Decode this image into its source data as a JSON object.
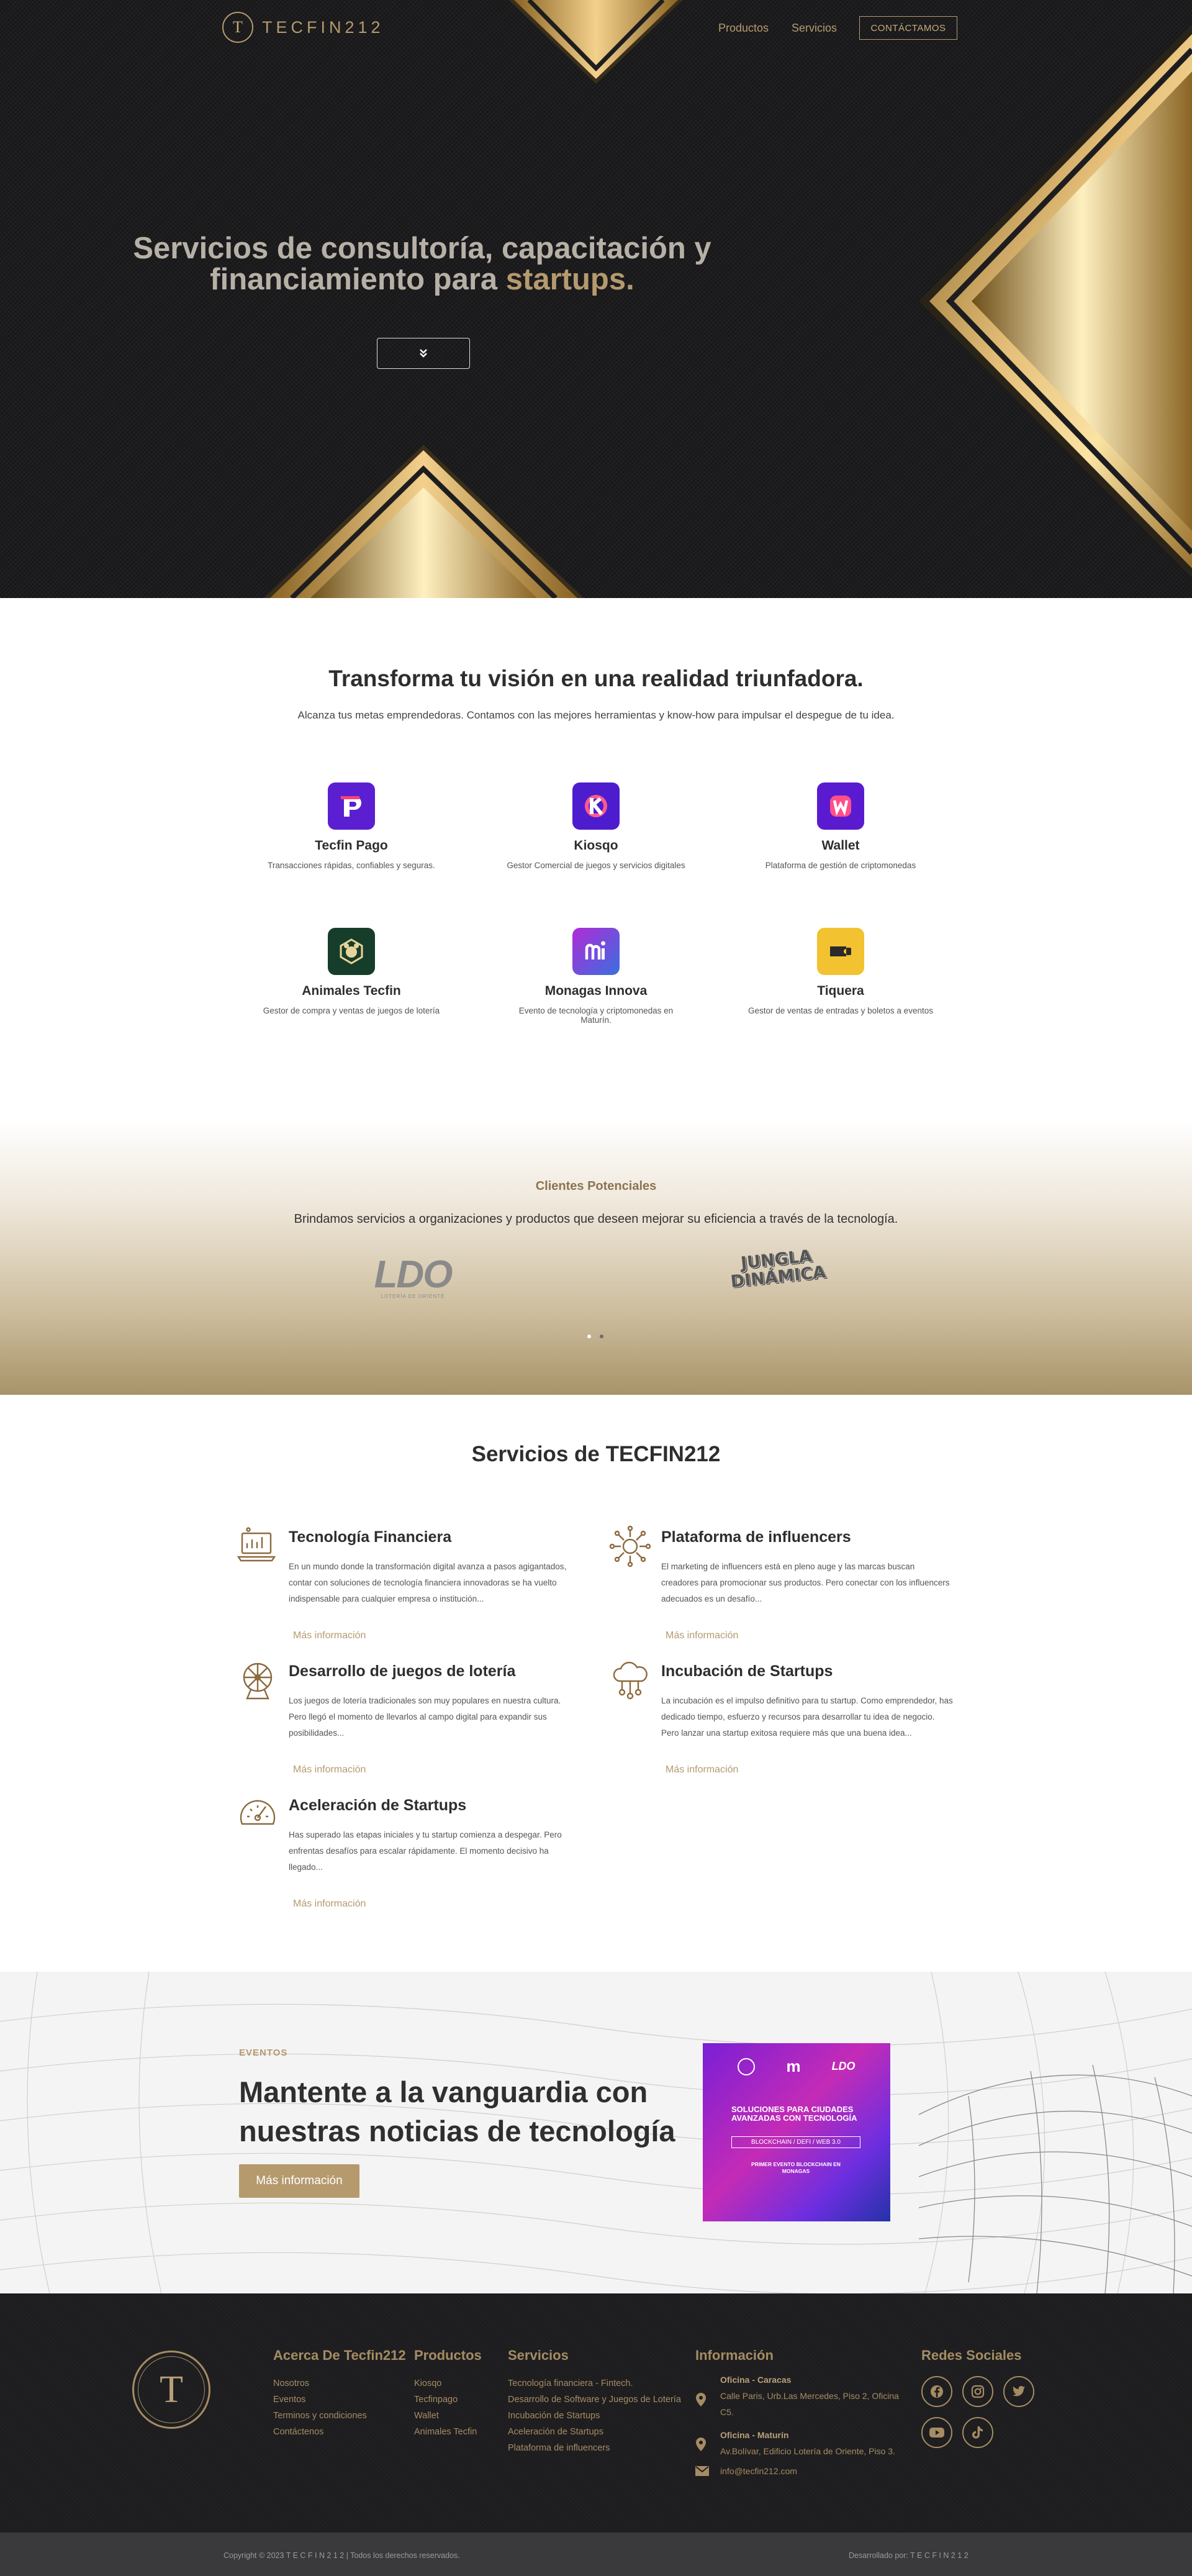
{
  "brand": {
    "name": "TECFIN212",
    "monogram": "T"
  },
  "nav": {
    "items": [
      "Productos",
      "Servicios"
    ],
    "cta": "CONTÁCTAMOS"
  },
  "hero": {
    "title_part1": "Servicios de consultoría, capacitación y",
    "title_part2": "financiamiento para ",
    "title_highlight": "startups.",
    "scroll_icon": "chevron-double-down-icon"
  },
  "vision": {
    "title": "Transforma tu visión en una realidad triunfadora.",
    "subtitle": "Alcanza tus metas emprendedoras. Contamos con las mejores herramientas y know-how para impulsar el despegue de tu idea."
  },
  "apps": [
    {
      "name": "Tecfin Pago",
      "desc": "Transacciones rápidas, confiables y seguras.",
      "color": "#5b1fd1",
      "glyph": "P"
    },
    {
      "name": "Kiosqo",
      "desc": "Gestor Comercial de juegos y servicios digitales",
      "color": "#4d1ccf",
      "glyph": "K"
    },
    {
      "name": "Wallet",
      "desc": "Plataforma de gestión de criptomonedas",
      "color": "#5a1bd0",
      "glyph": "W"
    },
    {
      "name": "Animales Tecfin",
      "desc": "Gestor de compra y ventas de juegos de lotería",
      "color": "#163d2a",
      "glyph": "A"
    },
    {
      "name": "Monagas Innova",
      "desc": "Evento de tecnología y criptomonedas en Maturín.",
      "color": "#7a3be0",
      "glyph": "m"
    },
    {
      "name": "Tiquera",
      "desc": "Gestor de ventas de entradas y boletos a eventos",
      "color": "#f2c230",
      "glyph": "T"
    }
  ],
  "clients": {
    "label": "Clientes Potenciales",
    "subtitle": "Brindamos servicios a organizaciones y productos que deseen mejorar su eficiencia a través de la tecnología.",
    "logos": [
      {
        "text": "LDO",
        "caption": "LOTERÍA DE ORIENTE"
      },
      {
        "text": "JUNGLA DINÁMICA",
        "caption": ""
      }
    ],
    "carousel": {
      "slides": 2,
      "active": 1
    }
  },
  "services": {
    "title": "Servicios de TECFIN212",
    "more_label": "Más información",
    "items": [
      {
        "title": "Tecnología Financiera",
        "text": "En un mundo donde la transformación digital avanza a pasos agigantados, contar con soluciones de tecnología financiera innovadoras se ha vuelto indispensable para cualquier empresa o institución...",
        "icon": "laptop-chart-icon"
      },
      {
        "title": "Plataforma de influencers",
        "text": "El marketing de influencers está en pleno auge y las marcas buscan creadores para promocionar sus productos. Pero conectar con los influencers adecuados es un desafío...",
        "icon": "network-hub-icon"
      },
      {
        "title": "Desarrollo de juegos de lotería",
        "text": "Los juegos de lotería tradicionales son muy populares en nuestra cultura. Pero llegó el momento de llevarlos al campo digital para expandir sus posibilidades...",
        "icon": "lottery-wheel-icon"
      },
      {
        "title": "Incubación de Startups",
        "text": "La incubación es el impulso definitivo para tu startup. Como emprendedor, has dedicado tiempo, esfuerzo y recursos para desarrollar tu idea de negocio. Pero lanzar una startup exitosa requiere más que una buena idea...",
        "icon": "cloud-network-icon"
      },
      {
        "title": "Aceleración de Startups",
        "text": "Has superado las etapas iniciales y tu startup comienza a despegar. Pero enfrentas desafíos para escalar rápidamente. El momento decisivo ha llegado...",
        "icon": "speedometer-icon"
      }
    ]
  },
  "events": {
    "tag": "EVENTOS",
    "title": "Mantente a la vanguardia con nuestras noticias de tecnología",
    "button": "Más información",
    "poster": {
      "headline": "SOLUCIONES PARA CIUDADES AVANZADAS CON TECNOLOGÍA",
      "tags": "BLOCKCHAIN / DEFI / WEB 3.0",
      "event": "PRIMER EVENTO BLOCKCHAIN EN MONAGAS"
    }
  },
  "footer": {
    "about": {
      "title": "Acerca De Tecfin212",
      "links": [
        "Nosotros",
        "Eventos",
        "Terminos y condiciones",
        "Contáctenos"
      ]
    },
    "products": {
      "title": "Productos",
      "links": [
        "Kiosqo",
        "Tecfinpago",
        "Wallet",
        "Animales Tecfin"
      ]
    },
    "services": {
      "title": "Servicios",
      "links": [
        "Tecnología financiera - Fintech.",
        "Desarrollo de Software y Juegos de Lotería",
        "Incubación de Startups",
        "Aceleración de Startups",
        "Plataforma de influencers"
      ]
    },
    "info": {
      "title": "Información",
      "office1_title": "Oficina - Caracas",
      "office1_addr": "Calle Paris, Urb.Las Mercedes, Piso 2, Oficina C5.",
      "office2_title": "Oficina - Maturín",
      "office2_addr": "Av.Bolívar, Edificio Lotería de Oriente, Piso 3.",
      "email": "info@tecfin212.com"
    },
    "social": {
      "title": "Redes Sociales",
      "icons": [
        "facebook-icon",
        "instagram-icon",
        "twitter-icon",
        "youtube-icon",
        "tiktok-icon"
      ]
    },
    "copyright": "Copyright © 2023 T E C F I N 2 1 2 | Todos los derechos reservados.",
    "credit": "Desarrollado por: T E C F I N 2 1 2"
  },
  "colors": {
    "gold": "#b59a6e",
    "dark": "#1d1d1f",
    "text": "#2e2e2e"
  }
}
